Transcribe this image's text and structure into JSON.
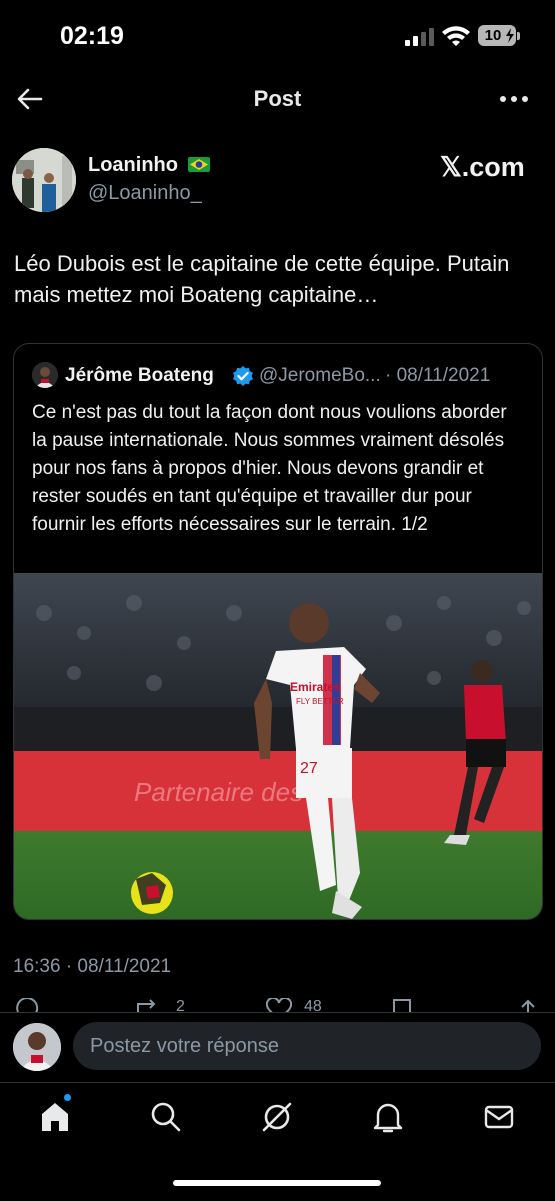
{
  "status_bar": {
    "time": "02:19",
    "battery": "10"
  },
  "header": {
    "title": "Post"
  },
  "tweet": {
    "author_name": "Loaninho",
    "author_handle": "@Loaninho_",
    "source_badge": "𝕏.com",
    "text": "Léo Dubois est le capitaine de cette équipe. Putain mais mettez moi Boateng capitaine…",
    "timestamp": "16:36 · 08/11/2021"
  },
  "quote": {
    "author_name": "Jérôme Boateng",
    "author_handle": "@JeromeBo...",
    "date": "· 08/11/2021",
    "text": "Ce n'est pas du tout la façon dont nous voulions aborder la pause internationale. Nous sommes vraiment désolés pour nos fans à propos d'hier. Nous devons grandir et rester soudés en tant qu'équipe et travailler dur pour fournir les efforts nécessaires sur le terrain. 1/2",
    "image_texts": {
      "sponsor": "Emirates",
      "sponsor_sub": "FLY BETTER",
      "jersey_number": "27",
      "board": "Partenaire des"
    }
  },
  "stats": {
    "reposts": "2",
    "likes": "48"
  },
  "reply": {
    "placeholder": "Postez votre réponse"
  },
  "tabs": [
    "home-icon",
    "search-icon",
    "grok-icon",
    "notifications-icon",
    "messages-icon"
  ],
  "colors": {
    "accent": "#1d9bf0",
    "background": "#000000",
    "secondary_text": "#8b98a5"
  }
}
